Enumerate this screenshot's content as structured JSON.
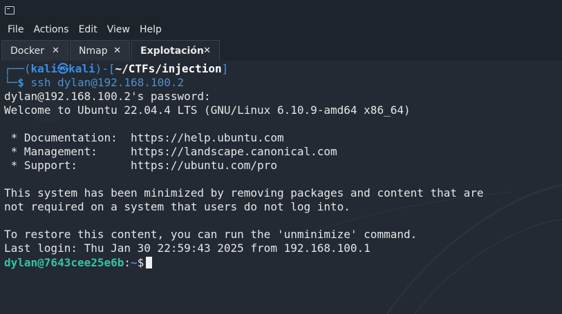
{
  "menu": [
    "File",
    "Actions",
    "Edit",
    "View",
    "Help"
  ],
  "tabs": [
    {
      "label": "Docker",
      "close": "✕"
    },
    {
      "label": "Nmap",
      "close": "✕"
    },
    {
      "label": "Explotación",
      "close": "✕"
    }
  ],
  "prompt": {
    "frame_top_left": "┌──(",
    "user": "kali",
    "at": "㉿",
    "host": "kali",
    "frame_mid": ")-[",
    "path": "~/CTFs/injection",
    "frame_end": "]",
    "frame_bottom": "└─",
    "dollar": "$",
    "command": "ssh dylan@192.168.100.2"
  },
  "output": [
    "dylan@192.168.100.2's password:",
    "Welcome to Ubuntu 22.04.4 LTS (GNU/Linux 6.10.9-amd64 x86_64)",
    "",
    " * Documentation:  https://help.ubuntu.com",
    " * Management:     https://landscape.canonical.com",
    " * Support:        https://ubuntu.com/pro",
    "",
    "This system has been minimized by removing packages and content that are",
    "not required on a system that users do not log into.",
    "",
    "To restore this content, you can run the 'unminimize' command.",
    "Last login: Thu Jan 30 22:59:43 2025 from 192.168.100.1"
  ],
  "remote_prompt": {
    "userhost": "dylan@7643cee25e6b",
    "colon": ":",
    "dir": "~",
    "dollar": "$"
  },
  "colors": {
    "background": "#232a33",
    "accent_blue": "#3a8ee6",
    "remote_green": "#35c4a6"
  }
}
